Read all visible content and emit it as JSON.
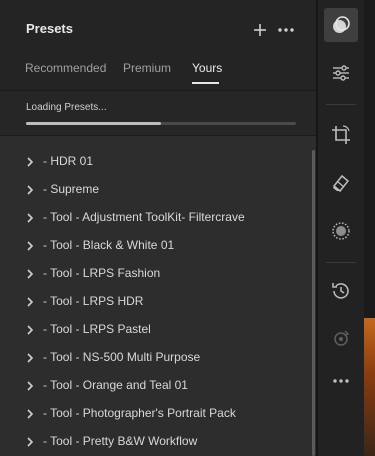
{
  "panel": {
    "title": "Presets",
    "add_icon": "plus-icon",
    "more_icon": "more-horizontal-icon"
  },
  "tabs": [
    {
      "label": "Recommended",
      "active": false
    },
    {
      "label": "Premium",
      "active": false
    },
    {
      "label": "Yours",
      "active": true
    }
  ],
  "loading": {
    "label": "Loading Presets...",
    "progress": 0.5
  },
  "presets": [
    {
      "label": "- HDR 01"
    },
    {
      "label": "- Supreme"
    },
    {
      "label": "- Tool - Adjustment ToolKit- Filtercrave"
    },
    {
      "label": "- Tool - Black & White 01"
    },
    {
      "label": "- Tool - LRPS Fashion"
    },
    {
      "label": "- Tool - LRPS HDR"
    },
    {
      "label": "- Tool - LRPS Pastel"
    },
    {
      "label": "- Tool - NS-500 Multi Purpose"
    },
    {
      "label": "- Tool - Orange and Teal 01"
    },
    {
      "label": "- Tool - Photographer's Portrait Pack"
    },
    {
      "label": "- Tool - Pretty B&W Workflow"
    }
  ],
  "toolbar": {
    "tools": [
      {
        "icon": "presets-icon",
        "active": true
      },
      {
        "icon": "sliders-icon",
        "active": false
      },
      {
        "icon": "crop-rotate-icon",
        "active": false
      },
      {
        "icon": "healing-eraser-icon",
        "active": false
      },
      {
        "icon": "masking-icon",
        "active": false
      },
      {
        "icon": "history-icon",
        "active": false
      },
      {
        "icon": "versions-icon",
        "active": false
      },
      {
        "icon": "more-horizontal-icon",
        "active": false
      }
    ]
  },
  "colors": {
    "panel_bg": "#2d2d2d",
    "header_bg": "#242424",
    "toolbar_bg": "#222222",
    "text": "#d9d9d9",
    "accent": "#e6e6e6"
  }
}
